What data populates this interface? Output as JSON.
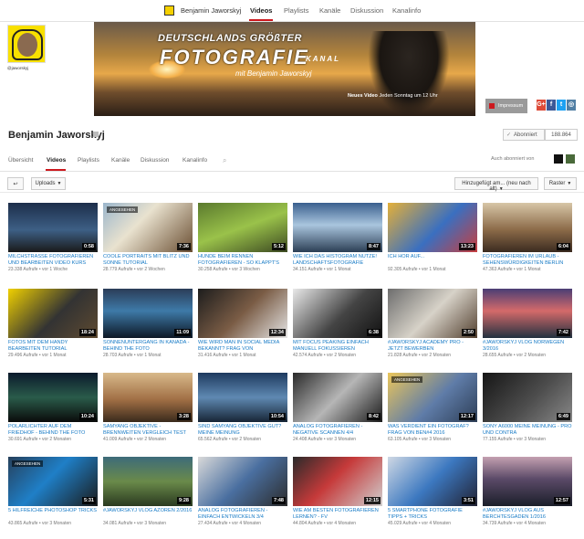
{
  "topnav": {
    "channel": "Benjamin Jaworskyj",
    "items": [
      "Videos",
      "Playlists",
      "Kanäle",
      "Diskussion",
      "Kanalinfo"
    ]
  },
  "banner": {
    "line1": "DEUTSCHLANDS GRÖßTER",
    "line2": "FOTOGRAFIE",
    "line2b": "KANAL",
    "line3": "mit Benjamin Jaworskyj",
    "schedule_bold": "Neues Video",
    "schedule": "Jeden Sonntag um 12 Uhr",
    "impressum": "Impressum",
    "social": [
      "G+",
      "f",
      "t",
      "◎"
    ]
  },
  "avatar_caption": "@jaworskyj",
  "header": {
    "name": "Benjamin Jaworskyj",
    "subscribe": "Abonniert",
    "subscribers": "188.864",
    "also_subscribed": "Auch abonniert von",
    "tabs": [
      "Übersicht",
      "Videos",
      "Playlists",
      "Kanäle",
      "Diskussion",
      "Kanalinfo"
    ]
  },
  "toolbar": {
    "back": "↩",
    "uploads": "Uploads",
    "sort": "Hinzugefügt am... (neu nach alt)",
    "view": "Raster"
  },
  "colors": {
    "accent": "#cc181e",
    "link": "#167ac6"
  },
  "videos": [
    {
      "title": "MILCHSTRAßE FOTOGRAFIEREN UND BEARBEITEN VIDEO KURS",
      "meta": "23.338 Aufrufe • vor 1 Woche",
      "dur": "0:58",
      "badge": ""
    },
    {
      "title": "COOLE PORTRAITS MIT BLITZ UND SONNE TUTORIAL",
      "meta": "28.779 Aufrufe • vor 2 Wochen",
      "dur": "7:36",
      "badge": "ANGESEHEN"
    },
    {
      "title": "HUNDE BEIM RENNEN FOTOGRAFIEREN - SO KLAPPT'S",
      "meta": "30.258 Aufrufe • vor 3 Wochen",
      "dur": "5:12",
      "badge": ""
    },
    {
      "title": "WIE ICH DAS HISTOGRAM NUTZE! Landschaftsfotografie",
      "meta": "34.151 Aufrufe • vor 1 Monat",
      "dur": "8:47",
      "badge": ""
    },
    {
      "title": "ICH HÖR AUF...",
      "meta": "92.305 Aufrufe • vor 1 Monat",
      "dur": "13:23",
      "badge": ""
    },
    {
      "title": "FOTOGRAFIEREN IM URLAUB - SEHENSWÜRDIGKEITEN BERLIN",
      "meta": "47.363 Aufrufe • vor 1 Monat",
      "dur": "6:04",
      "badge": ""
    },
    {
      "title": "FOTOS MIT DEM HANDY BEARBEITEN TUTORIAL",
      "meta": "29.496 Aufrufe • vor 1 Monat",
      "dur": "18:24",
      "badge": ""
    },
    {
      "title": "SONNENUNTERGANG IN KANADA - BEHIND THE FOTO",
      "meta": "28.703 Aufrufe • vor 1 Monat",
      "dur": "11:09",
      "badge": ""
    },
    {
      "title": "WIE WIRD MAN IN SOCIAL MEDIA BEKANNT? FRAG VON",
      "meta": "31.416 Aufrufe • vor 1 Monat",
      "dur": "12:34",
      "badge": ""
    },
    {
      "title": "MIT FOCUS PEAKING EINFACH MANUELL FOKUSSIEREN",
      "meta": "42.574 Aufrufe • vor 2 Monaten",
      "dur": "6:38",
      "badge": ""
    },
    {
      "title": "#jaworskyj ACADEMY PRO - JETZT BEWERBEN",
      "meta": "21.828 Aufrufe • vor 2 Monaten",
      "dur": "2:50",
      "badge": ""
    },
    {
      "title": "#jaworskyj VLOG NORWEGEN 3/2016",
      "meta": "28.655 Aufrufe • vor 2 Monaten",
      "dur": "7:42",
      "badge": ""
    },
    {
      "title": "POLARLICHTER AUF DEM FRIEDHOF - BEHIND THE FOTO",
      "meta": "30.691 Aufrufe • vor 2 Monaten",
      "dur": "10:24",
      "badge": ""
    },
    {
      "title": "SAMYANG OBJEKTIVE - BRENNWEITEN VERGLEICH TEST",
      "meta": "41.009 Aufrufe • vor 2 Monaten",
      "dur": "3:28",
      "badge": ""
    },
    {
      "title": "SIND SAMYANG OBJEKTIVE GUT? MEINE MEINUNG",
      "meta": "65.562 Aufrufe • vor 2 Monaten",
      "dur": "10:54",
      "badge": ""
    },
    {
      "title": "ANALOG FOTOGRAFIEREN - NEGATIVE SCANNEN 4/4",
      "meta": "24.408 Aufrufe • vor 3 Monaten",
      "dur": "8:42",
      "badge": ""
    },
    {
      "title": "WAS VERDIENT EIN FOTOGRAF? FRAG VON BEN#4 2016",
      "meta": "63.105 Aufrufe • vor 3 Monaten",
      "dur": "12:17",
      "badge": "ANGESEHEN"
    },
    {
      "title": "SONY A6000 MEINE MEINUNG - PRO UND CONTRA",
      "meta": "77.155 Aufrufe • vor 3 Monaten",
      "dur": "6:49",
      "badge": ""
    },
    {
      "title": "5 HILFREICHE PHOTOSHOP TRICKS",
      "meta": "43.865 Aufrufe • vor 3 Monaten",
      "dur": "5:31",
      "badge": "ANGESEHEN"
    },
    {
      "title": "#jaworskyj VLOG AZOREN 2/2016",
      "meta": "34.081 Aufrufe • vor 3 Monaten",
      "dur": "9:28",
      "badge": ""
    },
    {
      "title": "ANALOG FOTOGRAFIEREN - EINFACH ENTWICKELN 3/4",
      "meta": "27.434 Aufrufe • vor 4 Monaten",
      "dur": "7:48",
      "badge": ""
    },
    {
      "title": "WIE AM BESTEN FOTOGRAFIEREN LERNEN? - Fv",
      "meta": "44.804 Aufrufe • vor 4 Monaten",
      "dur": "12:15",
      "badge": ""
    },
    {
      "title": "5 SMARTPHONE FOTOGRAFIE TIPPS + TRICKS",
      "meta": "45.029 Aufrufe • vor 4 Monaten",
      "dur": "3:51",
      "badge": ""
    },
    {
      "title": "#jaworskyj VLOG AUS BERCHTESGADEN 1/2016",
      "meta": "34.739 Aufrufe • vor 4 Monaten",
      "dur": "12:57",
      "badge": ""
    }
  ]
}
